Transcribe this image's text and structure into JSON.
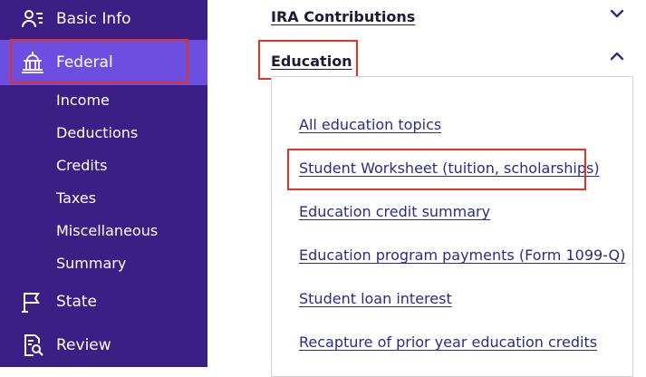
{
  "sidebar": {
    "basic_info": {
      "label": "Basic Info",
      "icon": "person-list-icon"
    },
    "federal": {
      "label": "Federal",
      "icon": "capitol-building-icon"
    },
    "federal_items": [
      "Income",
      "Deductions",
      "Credits",
      "Taxes",
      "Miscellaneous",
      "Summary"
    ],
    "state": {
      "label": "State",
      "icon": "flag-icon"
    },
    "review": {
      "label": "Review",
      "icon": "document-search-icon"
    }
  },
  "main": {
    "ira_contributions": {
      "label": "IRA Contributions",
      "icon": "chevron-down-icon"
    },
    "education": {
      "label": "Education",
      "icon": "chevron-up-icon",
      "links": [
        "All education topics",
        "Student Worksheet (tuition, scholarships)",
        "Education credit summary",
        "Education program payments (Form 1099-Q)",
        "Student loan interest",
        "Recapture of prior year education credits"
      ]
    }
  },
  "colors": {
    "sidebar_bg": "#3b1f84",
    "sidebar_active": "#6c4fe0",
    "highlight_box": "#e3321e",
    "link": "#2c2a8c"
  }
}
